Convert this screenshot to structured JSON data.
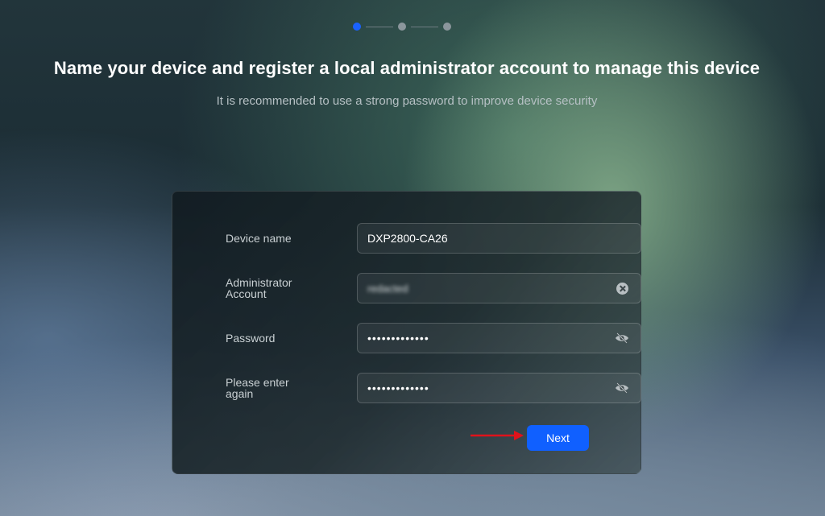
{
  "stepper": {
    "total_steps": 3,
    "current_step": 1
  },
  "header": {
    "title": "Name your device and register a local administrator account to manage this device",
    "subtitle": "It is recommended to use a strong password to improve device security"
  },
  "form": {
    "device_name": {
      "label": "Device name",
      "value": "DXP2800-CA26"
    },
    "admin_account": {
      "label": "Administrator Account",
      "value": "redacted",
      "icon": "clear-icon"
    },
    "password": {
      "label": "Password",
      "value": "•••••••••••••",
      "icon": "eye-hidden-icon"
    },
    "confirm_password": {
      "label": "Please enter again",
      "value": "•••••••••••••",
      "icon": "eye-hidden-icon"
    },
    "next_button": "Next"
  },
  "colors": {
    "accent": "#1060ff",
    "annotation_arrow": "#e0121b"
  }
}
